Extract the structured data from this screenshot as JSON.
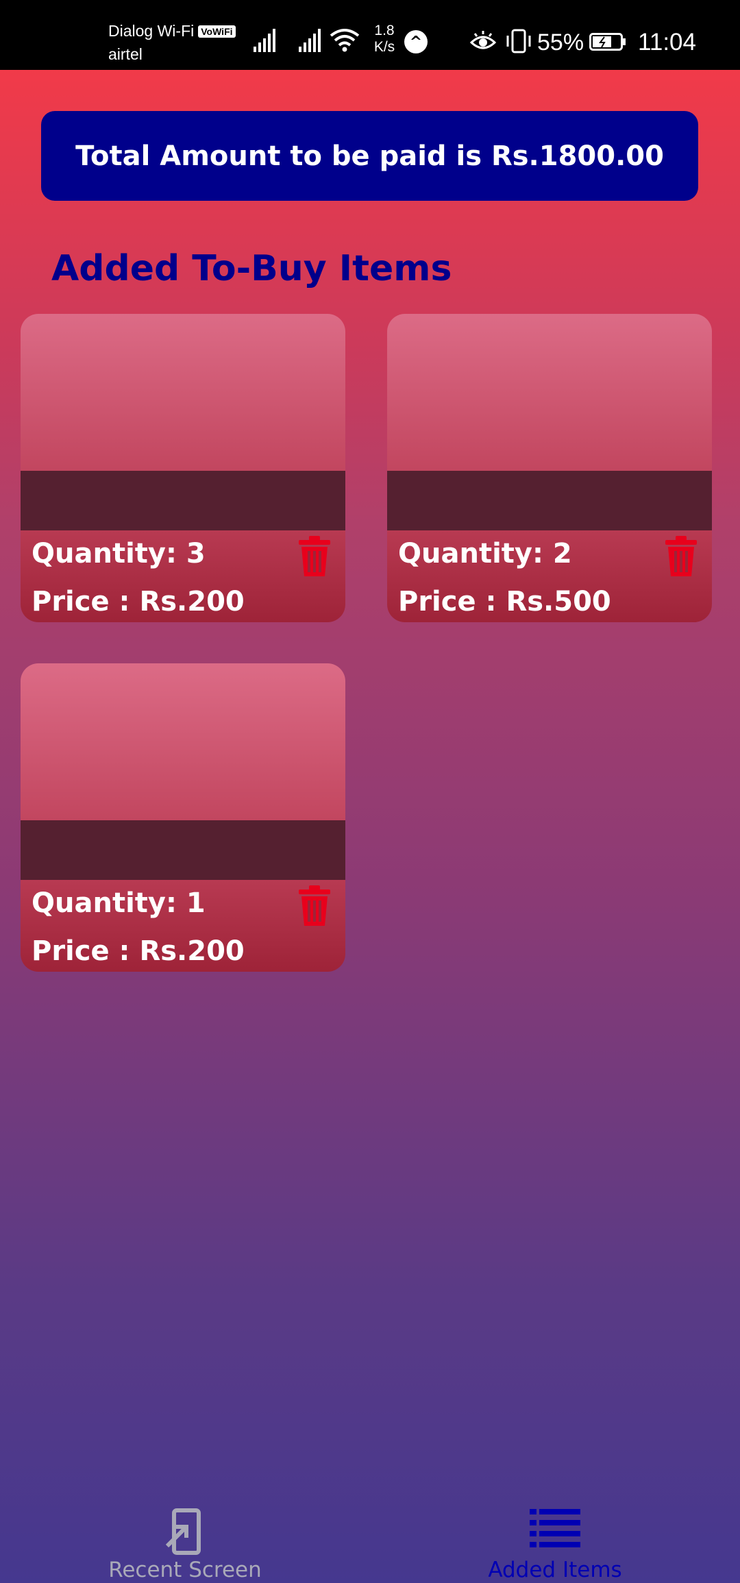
{
  "status_bar": {
    "carrier_line1": "Dialog Wi-Fi",
    "vowifi_badge": "VoWiFi",
    "carrier_line2": "airtel",
    "net_speed_value": "1.8",
    "net_speed_unit": "K/s",
    "app_indicator": "^",
    "battery_percent": "55%",
    "time": "11:04"
  },
  "summary": {
    "total_text": "Total Amount to be paid is Rs.1800.00"
  },
  "section": {
    "title": "Added To-Buy Items"
  },
  "items": [
    {
      "quantity": "Quantity: 3",
      "price": "Price : Rs.200"
    },
    {
      "quantity": "Quantity: 2",
      "price": "Price : Rs.500"
    },
    {
      "quantity": "Quantity: 1",
      "price": "Price : Rs.200"
    }
  ],
  "bottom_nav": {
    "recent_label": "Recent Screen",
    "added_label": "Added Items",
    "recent_icon": "open-in-app-icon",
    "added_icon": "list-icon"
  },
  "colors": {
    "banner": "#00008b",
    "title": "#00008b",
    "trash": "#e8001c",
    "nav_active": "#0000b3",
    "nav_inactive": "#a9a9b8"
  }
}
